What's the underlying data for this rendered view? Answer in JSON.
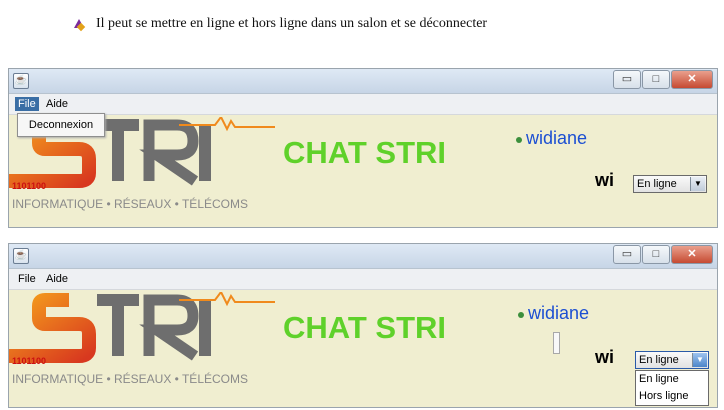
{
  "document": {
    "bullet_icon": "arrow-bullet-icon",
    "caption": "Il peut se mettre en ligne et hors ligne dans un salon  et se déconnecter"
  },
  "window": {
    "icon": "java-cup-icon",
    "controls": {
      "minimize": "▭",
      "maximize": "□",
      "close": "✕"
    }
  },
  "menubar": {
    "file_label": "File",
    "help_label": "Aide"
  },
  "file_menu": {
    "items": [
      "Deconnexion"
    ]
  },
  "logo": {
    "text": "STRI",
    "binary": "1101100",
    "tagline": "INFORMATIQUE • RÉSEAUX • TÉLÉCOMS"
  },
  "chat": {
    "title": "CHAT STRI",
    "online_users": [
      "widiane"
    ],
    "login": "wi",
    "status_selected": "En ligne",
    "status_options": [
      "En ligne",
      "Hors ligne"
    ]
  },
  "colors": {
    "title_green": "#5fd12a",
    "user_blue": "#1c4fd2",
    "logo_red": "#d8381f",
    "logo_orange": "#f08a1c",
    "logo_gray": "#6e6e6e"
  }
}
